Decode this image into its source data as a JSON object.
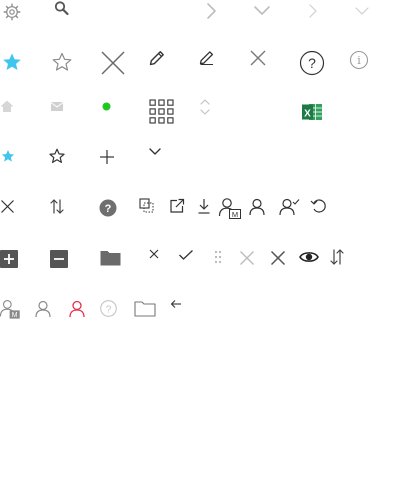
{
  "icons": {
    "gear": "gear-icon",
    "search": "search-icon",
    "chevron_right": "chevron-right-icon",
    "chevron_down": "chevron-down-icon",
    "star_filled": "star-filled-icon",
    "star_outline": "star-outline-icon",
    "close": "close-icon",
    "pencil": "pencil-icon",
    "help_circle": "help-circle-icon",
    "info_circle": "info-circle-icon",
    "home": "home-icon",
    "mail": "mail-icon",
    "status_dot": "status-dot-icon",
    "grid": "grid-icon",
    "sort_vertical": "sort-vertical-icon",
    "excel": "excel-icon",
    "plus": "plus-icon",
    "swap_vertical": "swap-vertical-icon",
    "select_region": "select-region-icon",
    "external_link": "external-link-icon",
    "download": "download-icon",
    "user_managed": "user-managed-icon",
    "user": "user-icon",
    "user_check": "user-check-icon",
    "undo": "undo-icon",
    "plus_square": "plus-square-icon",
    "minus_square": "minus-square-icon",
    "folder": "folder-icon",
    "check": "check-icon",
    "drag_handle": "drag-handle-icon",
    "eye": "eye-icon",
    "arrow_left": "arrow-left-icon"
  },
  "text": {
    "question_mark": "?",
    "info_letter": "i",
    "managed_badge": "M",
    "excel_letter": "X"
  },
  "colors": {
    "dark_gray": "#4a4a4a",
    "mid_gray": "#666666",
    "light_gray": "#b8b8b8",
    "lighter_gray": "#cfcfcf",
    "accent_cyan": "#3fc5ef",
    "status_green": "#22c622",
    "excel_green": "#1d7a45",
    "excel_light": "#33a05d",
    "user_red": "#e4304a",
    "circle_gray": "#6f6f6f"
  }
}
